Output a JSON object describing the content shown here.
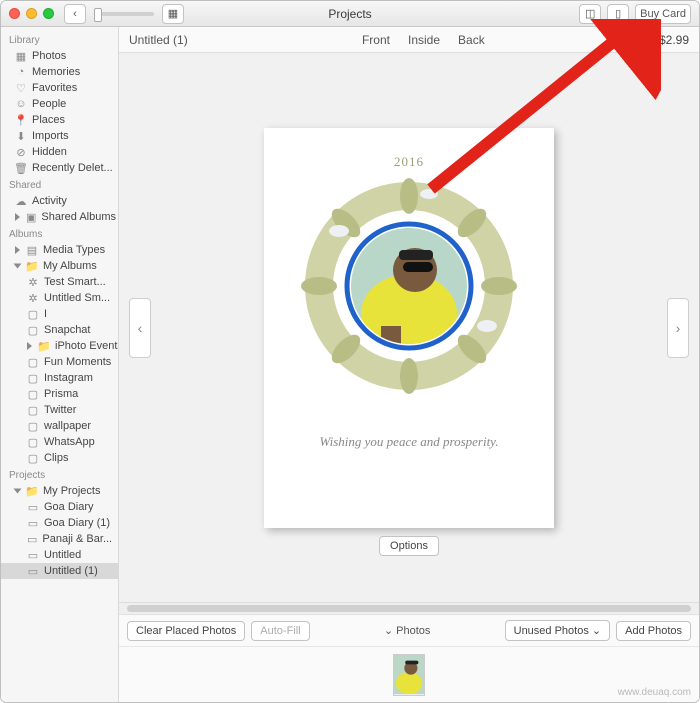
{
  "titlebar": {
    "title": "Projects",
    "buy_label": "Buy Card"
  },
  "subheader": {
    "doc_title": "Untitled (1)",
    "tabs": {
      "front": "Front",
      "inside": "Inside",
      "back": "Back"
    },
    "price": "$2.99"
  },
  "sidebar": {
    "sections": {
      "library": "Library",
      "shared": "Shared",
      "albums": "Albums",
      "projects": "Projects"
    },
    "library_items": [
      {
        "icon": "photos-icon",
        "label": "Photos"
      },
      {
        "icon": "memories-icon",
        "label": "Memories"
      },
      {
        "icon": "favorites-icon",
        "label": "Favorites"
      },
      {
        "icon": "people-icon",
        "label": "People"
      },
      {
        "icon": "places-icon",
        "label": "Places"
      },
      {
        "icon": "imports-icon",
        "label": "Imports"
      },
      {
        "icon": "hidden-icon",
        "label": "Hidden"
      },
      {
        "icon": "trash-icon",
        "label": "Recently Delet..."
      }
    ],
    "shared_items": [
      {
        "icon": "cloud-icon",
        "label": "Activity"
      },
      {
        "icon": "shared-album-icon",
        "label": "Shared Albums"
      }
    ],
    "albums_items": [
      {
        "icon": "media-types-icon",
        "label": "Media Types",
        "disclosure": "closed"
      },
      {
        "icon": "folder-icon",
        "label": "My Albums",
        "disclosure": "open",
        "children": [
          {
            "icon": "smart-album-icon",
            "label": "Test Smart..."
          },
          {
            "icon": "smart-album-icon",
            "label": "Untitled Sm..."
          },
          {
            "icon": "album-icon",
            "label": "I"
          },
          {
            "icon": "album-icon",
            "label": "Snapchat"
          },
          {
            "icon": "folder-icon",
            "label": "iPhoto Events",
            "disclosure": "closed"
          },
          {
            "icon": "album-icon",
            "label": "Fun Moments"
          },
          {
            "icon": "album-icon",
            "label": "Instagram"
          },
          {
            "icon": "album-icon",
            "label": "Prisma"
          },
          {
            "icon": "album-icon",
            "label": "Twitter"
          },
          {
            "icon": "album-icon",
            "label": "wallpaper"
          },
          {
            "icon": "album-icon",
            "label": "WhatsApp"
          },
          {
            "icon": "album-icon",
            "label": "Clips"
          }
        ]
      }
    ],
    "projects_items": [
      {
        "icon": "folder-icon",
        "label": "My Projects",
        "disclosure": "open",
        "children": [
          {
            "icon": "book-icon",
            "label": "Goa Diary"
          },
          {
            "icon": "book-icon",
            "label": "Goa Diary (1)"
          },
          {
            "icon": "book-icon",
            "label": "Panaji & Bar..."
          },
          {
            "icon": "book-icon",
            "label": "Untitled"
          },
          {
            "icon": "book-icon",
            "label": "Untitled (1)",
            "selected": true
          }
        ]
      }
    ]
  },
  "card": {
    "year": "2016",
    "message": "Wishing you peace and prosperity.",
    "options_label": "Options"
  },
  "bottom": {
    "clear_placed": "Clear Placed Photos",
    "auto_fill": "Auto-Fill",
    "photos_toggle": "Photos",
    "unused": "Unused Photos",
    "add": "Add Photos"
  },
  "watermark": "www.deuaq.com",
  "colors": {
    "wreath": "#b8bd86",
    "ring": "#1f62c9",
    "shirt": "#e7e33a",
    "skin": "#7a5a3e",
    "arrow": "#e2231a"
  }
}
